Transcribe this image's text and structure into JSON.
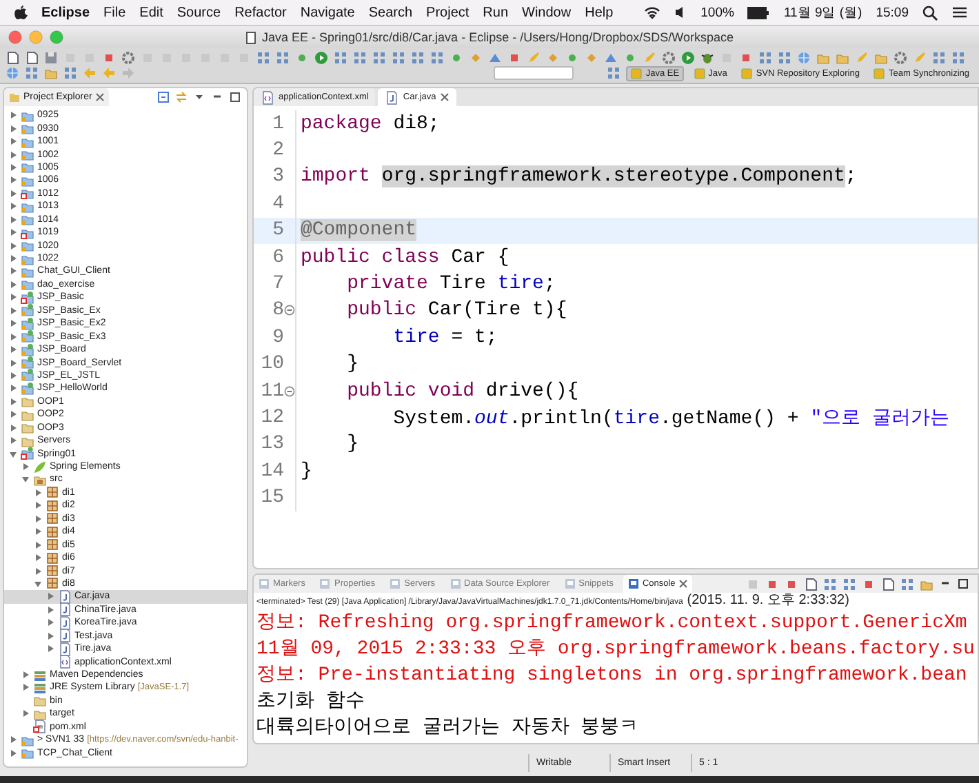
{
  "menu_bar": {
    "app": "Eclipse",
    "items": [
      "File",
      "Edit",
      "Source",
      "Refactor",
      "Navigate",
      "Search",
      "Project",
      "Run",
      "Window",
      "Help"
    ],
    "battery": "100%",
    "date": "11월 9일 (월)",
    "time": "15:09"
  },
  "window": {
    "title": "Java EE - Spring01/src/di8/Car.java - Eclipse - /Users/Hong/Dropbox/SDS/Workspace"
  },
  "perspectives": [
    {
      "label": "Java EE",
      "selected": true
    },
    {
      "label": "Java",
      "selected": false
    },
    {
      "label": "SVN Repository Exploring",
      "selected": false
    },
    {
      "label": "Team Synchronizing",
      "selected": false
    }
  ],
  "project_explorer": {
    "title": "Project Explorer",
    "tree": [
      {
        "label": "0925",
        "kind": "project",
        "expanded": false,
        "error": false,
        "selected": false
      },
      {
        "label": "0930",
        "kind": "project",
        "expanded": false,
        "error": false,
        "selected": false
      },
      {
        "label": "1001",
        "kind": "project",
        "expanded": false,
        "error": false,
        "selected": false
      },
      {
        "label": "1002",
        "kind": "project",
        "expanded": false,
        "error": false,
        "selected": false
      },
      {
        "label": "1005",
        "kind": "project",
        "expanded": false,
        "error": false,
        "selected": false
      },
      {
        "label": "1006",
        "kind": "project",
        "expanded": false,
        "error": false,
        "selected": false
      },
      {
        "label": "1012",
        "kind": "project",
        "expanded": false,
        "error": true,
        "selected": false
      },
      {
        "label": "1013",
        "kind": "project",
        "expanded": false,
        "error": false,
        "selected": false
      },
      {
        "label": "1014",
        "kind": "project",
        "expanded": false,
        "error": false,
        "selected": false
      },
      {
        "label": "1019",
        "kind": "project",
        "expanded": false,
        "error": true,
        "selected": false
      },
      {
        "label": "1020",
        "kind": "project",
        "expanded": false,
        "error": false,
        "selected": false
      },
      {
        "label": "1022",
        "kind": "project",
        "expanded": false,
        "error": false,
        "selected": false
      },
      {
        "label": "Chat_GUI_Client",
        "kind": "project",
        "expanded": false,
        "error": false,
        "selected": false
      },
      {
        "label": "dao_exercise",
        "kind": "project",
        "expanded": false,
        "error": false,
        "selected": false
      },
      {
        "label": "JSP_Basic",
        "kind": "webproject",
        "expanded": false,
        "error": true,
        "selected": false
      },
      {
        "label": "JSP_Basic_Ex",
        "kind": "webproject",
        "expanded": false,
        "error": false,
        "selected": false
      },
      {
        "label": "JSP_Basic_Ex2",
        "kind": "webproject",
        "expanded": false,
        "error": false,
        "selected": false
      },
      {
        "label": "JSP_Basic_Ex3",
        "kind": "webproject",
        "expanded": false,
        "error": false,
        "selected": false
      },
      {
        "label": "JSP_Board",
        "kind": "webproject",
        "expanded": false,
        "error": false,
        "selected": false
      },
      {
        "label": "JSP_Board_Servlet",
        "kind": "webproject",
        "expanded": false,
        "error": false,
        "selected": false
      },
      {
        "label": "JSP_EL_JSTL",
        "kind": "webproject",
        "expanded": false,
        "error": false,
        "selected": false
      },
      {
        "label": "JSP_HelloWorld",
        "kind": "webproject",
        "expanded": false,
        "error": false,
        "selected": false
      },
      {
        "label": "OOP1",
        "kind": "folder",
        "expanded": false,
        "error": false,
        "selected": false
      },
      {
        "label": "OOP2",
        "kind": "folder",
        "expanded": false,
        "error": false,
        "selected": false
      },
      {
        "label": "OOP3",
        "kind": "folder",
        "expanded": false,
        "error": false,
        "selected": false
      },
      {
        "label": "Servers",
        "kind": "folder",
        "expanded": false,
        "error": false,
        "selected": false
      },
      {
        "label": "Spring01",
        "kind": "springproject",
        "expanded": true,
        "error": true,
        "selected": false,
        "children": [
          {
            "label": "Spring Elements",
            "kind": "spring",
            "expanded": false,
            "error": false,
            "selected": false
          },
          {
            "label": "src",
            "kind": "source",
            "expanded": true,
            "error": false,
            "selected": false,
            "children": [
              {
                "label": "di1",
                "kind": "package",
                "expanded": false,
                "error": false,
                "selected": false
              },
              {
                "label": "di2",
                "kind": "package",
                "expanded": false,
                "error": false,
                "selected": false
              },
              {
                "label": "di3",
                "kind": "package",
                "expanded": false,
                "error": false,
                "selected": false
              },
              {
                "label": "di4",
                "kind": "package",
                "expanded": false,
                "error": false,
                "selected": false
              },
              {
                "label": "di5",
                "kind": "package",
                "expanded": false,
                "error": false,
                "selected": false
              },
              {
                "label": "di6",
                "kind": "package",
                "expanded": false,
                "error": false,
                "selected": false
              },
              {
                "label": "di7",
                "kind": "package",
                "expanded": false,
                "error": false,
                "selected": false
              },
              {
                "label": "di8",
                "kind": "package",
                "expanded": true,
                "error": false,
                "selected": false,
                "children": [
                  {
                    "label": "Car.java",
                    "kind": "java",
                    "expanded": false,
                    "error": false,
                    "selected": true
                  },
                  {
                    "label": "ChinaTire.java",
                    "kind": "java",
                    "expanded": false,
                    "error": false,
                    "selected": false
                  },
                  {
                    "label": "KoreaTire.java",
                    "kind": "java",
                    "expanded": false,
                    "error": false,
                    "selected": false
                  },
                  {
                    "label": "Test.java",
                    "kind": "java",
                    "expanded": false,
                    "error": false,
                    "selected": false
                  },
                  {
                    "label": "Tire.java",
                    "kind": "java",
                    "expanded": false,
                    "error": false,
                    "selected": false
                  },
                  {
                    "label": "applicationContext.xml",
                    "kind": "xml",
                    "expandable": false,
                    "error": false,
                    "selected": false
                  }
                ]
              }
            ]
          },
          {
            "label": "Maven Dependencies",
            "kind": "library",
            "expanded": false,
            "error": false,
            "selected": false
          },
          {
            "label": "JRE System Library",
            "suffix": "[JavaSE-1.7]",
            "kind": "library",
            "expanded": false,
            "error": false,
            "selected": false
          },
          {
            "label": "bin",
            "kind": "folder",
            "expandable": false,
            "error": false,
            "selected": false
          },
          {
            "label": "target",
            "kind": "folder",
            "expanded": false,
            "error": false,
            "selected": false
          },
          {
            "label": "pom.xml",
            "kind": "pom",
            "expandable": false,
            "error": true,
            "selected": false
          }
        ]
      },
      {
        "label": "> SVN1 33",
        "suffix": "[https://dev.naver.com/svn/edu-hanbit-",
        "kind": "project",
        "expanded": false,
        "error": false,
        "selected": false
      },
      {
        "label": "TCP_Chat_Client",
        "kind": "project",
        "expanded": false,
        "error": false,
        "selected": false
      }
    ]
  },
  "editor": {
    "tabs": [
      {
        "label": "applicationContext.xml",
        "kind": "xml",
        "selected": false
      },
      {
        "label": "Car.java",
        "kind": "java",
        "selected": true
      }
    ],
    "lines": [
      {
        "number": "1",
        "fold": false,
        "current": false,
        "tokens": [
          {
            "text": "package ",
            "kind": "keyword"
          },
          {
            "text": "di8;",
            "kind": "plain"
          }
        ]
      },
      {
        "number": "2",
        "fold": false,
        "current": false
      },
      {
        "number": "3",
        "fold": false,
        "current": false,
        "tokens": [
          {
            "text": "import ",
            "kind": "keyword"
          },
          {
            "text": "org.springframework.stereotype.Component",
            "kind": "occurrence"
          },
          {
            "text": ";",
            "kind": "plain"
          }
        ]
      },
      {
        "number": "4",
        "fold": false,
        "current": false
      },
      {
        "number": "5",
        "fold": false,
        "current": true,
        "tokens": [
          {
            "text": "@Component",
            "kind": "annotation"
          }
        ]
      },
      {
        "number": "6",
        "fold": false,
        "current": false,
        "tokens": [
          {
            "text": "public class ",
            "kind": "keyword"
          },
          {
            "text": "Car {",
            "kind": "plain"
          }
        ]
      },
      {
        "number": "7",
        "fold": false,
        "current": false,
        "tokens": [
          {
            "text": "    private ",
            "kind": "keyword"
          },
          {
            "text": "Tire ",
            "kind": "plain"
          },
          {
            "text": "tire",
            "kind": "field"
          },
          {
            "text": ";",
            "kind": "plain"
          }
        ]
      },
      {
        "number": "8",
        "fold": true,
        "current": false,
        "tokens": [
          {
            "text": "    public ",
            "kind": "keyword"
          },
          {
            "text": "Car(Tire t){",
            "kind": "plain"
          }
        ]
      },
      {
        "number": "9",
        "fold": false,
        "current": false,
        "tokens": [
          {
            "text": "        tire",
            "kind": "field"
          },
          {
            "text": " = t;",
            "kind": "plain"
          }
        ]
      },
      {
        "number": "10",
        "fold": false,
        "current": false,
        "tokens": [
          {
            "text": "    }",
            "kind": "plain"
          }
        ]
      },
      {
        "number": "11",
        "fold": true,
        "current": false,
        "tokens": [
          {
            "text": "    public void ",
            "kind": "keyword"
          },
          {
            "text": "drive(){",
            "kind": "plain"
          }
        ]
      },
      {
        "number": "12",
        "fold": false,
        "current": false,
        "tokens": [
          {
            "text": "        System.",
            "kind": "plain"
          },
          {
            "text": "out",
            "kind": "static"
          },
          {
            "text": ".println(",
            "kind": "plain"
          },
          {
            "text": "tire",
            "kind": "field"
          },
          {
            "text": ".getName() + ",
            "kind": "plain"
          },
          {
            "text": "\"으로 굴러가는",
            "kind": "string"
          }
        ]
      },
      {
        "number": "13",
        "fold": false,
        "current": false,
        "tokens": [
          {
            "text": "    }",
            "kind": "plain"
          }
        ]
      },
      {
        "number": "14",
        "fold": false,
        "current": false,
        "tokens": [
          {
            "text": "}",
            "kind": "plain"
          }
        ]
      },
      {
        "number": "15",
        "fold": false,
        "current": false
      }
    ]
  },
  "bottom_panel": {
    "tabs": [
      {
        "label": "Markers",
        "selected": false
      },
      {
        "label": "Properties",
        "selected": false
      },
      {
        "label": "Servers",
        "selected": false
      },
      {
        "label": "Data Source Explorer",
        "selected": false
      },
      {
        "label": "Snippets",
        "selected": false
      },
      {
        "label": "Console",
        "selected": true
      }
    ],
    "launch_info": "<terminated> Test (29) [Java Application] /Library/Java/JavaVirtualMachines/jdk1.7.0_71.jdk/Contents/Home/bin/java",
    "launch_time": "(2015. 11. 9. 오후 2:33:32)",
    "lines": [
      {
        "text": "정보: Refreshing org.springframework.context.support.GenericXm",
        "kind": "error"
      },
      {
        "text": "11월 09, 2015 2:33:33 오후 org.springframework.beans.factory.su",
        "kind": "error"
      },
      {
        "text": "정보: Pre-instantiating singletons in org.springframework.bean",
        "kind": "error"
      },
      {
        "text": "초기화 함수",
        "kind": "output"
      },
      {
        "text": "대륙의타이어으로 굴러가는 자동차 붕붕ㅋ",
        "kind": "output"
      }
    ]
  },
  "status_bar": [
    "Writable",
    "Smart Insert",
    "5 : 1"
  ]
}
